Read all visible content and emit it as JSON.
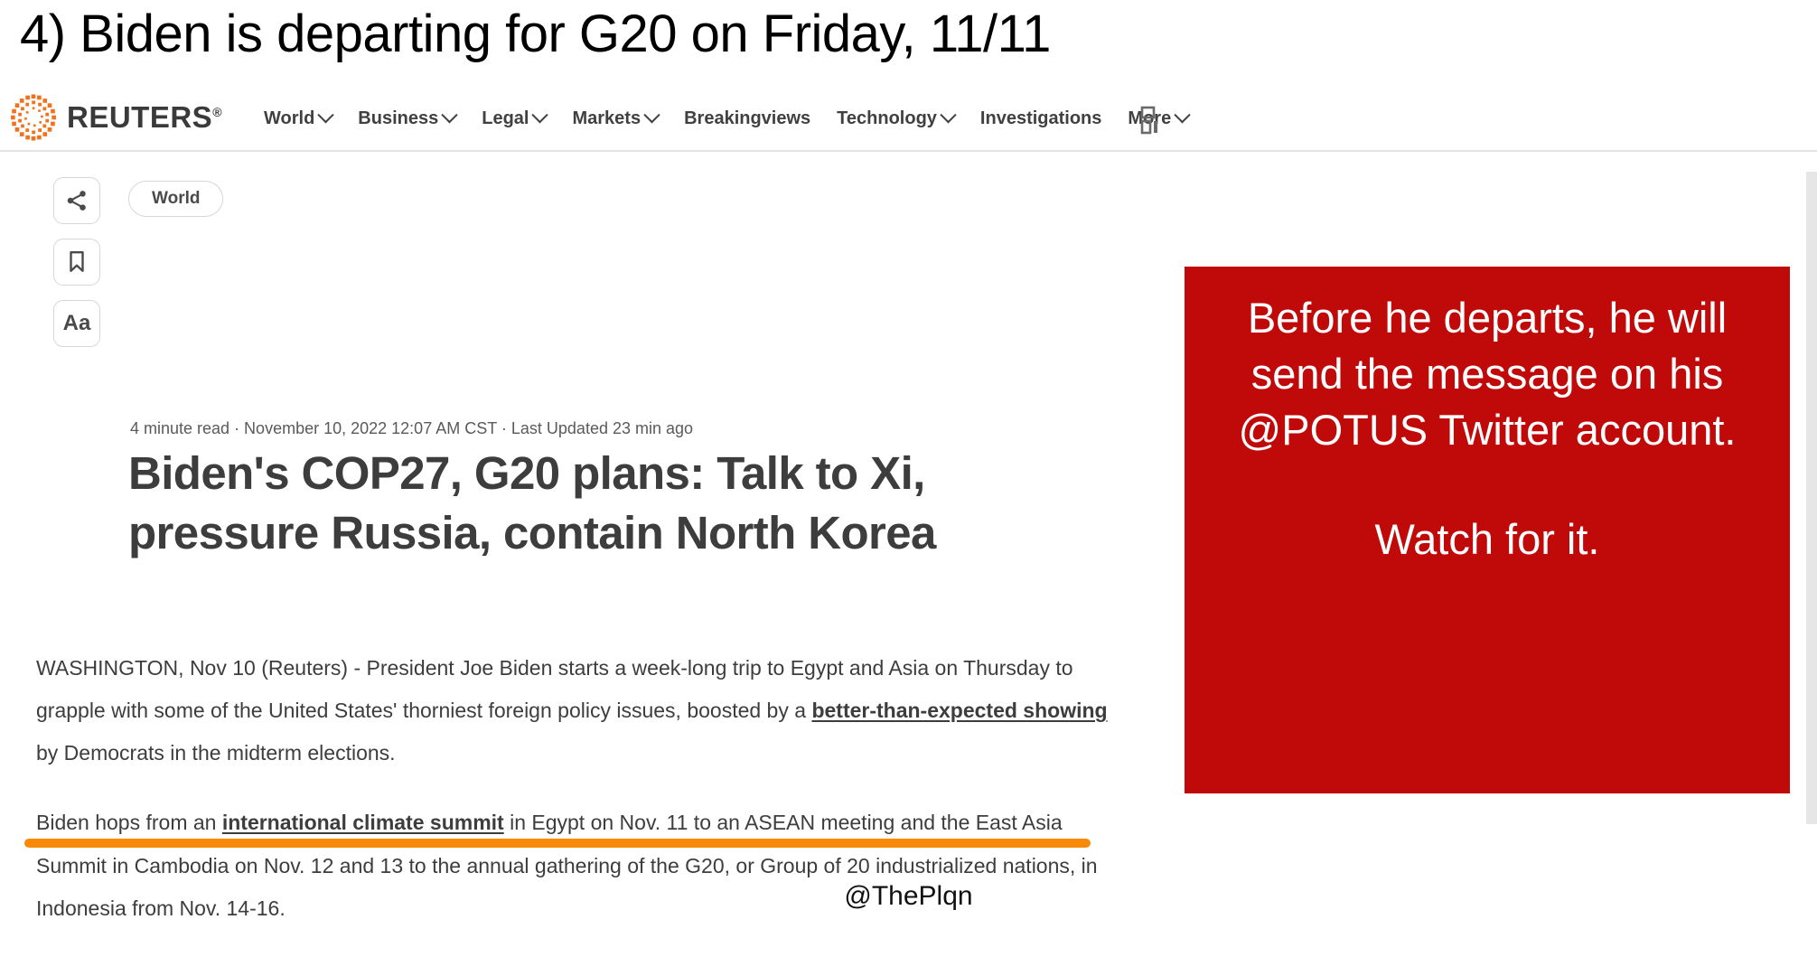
{
  "slide": {
    "title": "4) Biden is departing for G20 on Friday, 11/11",
    "watermark": "@ThePlqn"
  },
  "site": {
    "brand": "REUTERS",
    "brand_registered": "®",
    "logo_icon": "reuters-dot-spiral-logo",
    "brand_color": "#f97316",
    "nav": [
      {
        "label": "World",
        "has_dropdown": true
      },
      {
        "label": "Business",
        "has_dropdown": true
      },
      {
        "label": "Legal",
        "has_dropdown": true
      },
      {
        "label": "Markets",
        "has_dropdown": true
      },
      {
        "label": "Breakingviews",
        "has_dropdown": false
      },
      {
        "label": "Technology",
        "has_dropdown": true
      },
      {
        "label": "Investigations",
        "has_dropdown": false
      },
      {
        "label": "More",
        "has_dropdown": true
      }
    ],
    "nav_end_icon": "menu-grid-icon"
  },
  "article": {
    "rail_buttons": [
      {
        "icon": "share-icon",
        "label": ""
      },
      {
        "icon": "bookmark-icon",
        "label": ""
      },
      {
        "icon": "text-size-icon",
        "label": "Aa"
      }
    ],
    "section_badge": "World",
    "meta": "4 minute read · November 10, 2022 12:07 AM CST · Last Updated 23 min ago",
    "headline": "Biden's COP27, G20 plans: Talk to Xi, pressure Russia, contain North Korea",
    "paragraphs": [
      {
        "parts": [
          {
            "text": "WASHINGTON, Nov 10 (Reuters) - President Joe Biden starts a week-long trip to Egypt and Asia on Thursday to grapple with some of the United States' thorniest foreign policy issues, boosted by a ",
            "link": false
          },
          {
            "text": "better-than-expected showing",
            "link": true
          },
          {
            "text": " by Democrats in the midterm elections.",
            "link": false
          }
        ]
      },
      {
        "parts": [
          {
            "text": "Biden hops from an ",
            "link": false
          },
          {
            "text": "international climate summit",
            "link": true
          },
          {
            "text": " in Egypt on Nov. 11 to an ASEAN meeting and the East Asia Summit in Cambodia on Nov. 12 and 13 to the annual gathering of the G20, or Group of 20 industrialized nations, in Indonesia from Nov. 14-16.",
            "link": false
          }
        ]
      }
    ],
    "highlight_color": "#f98a07"
  },
  "callout": {
    "background_color": "#c00a0a",
    "text_color": "#ffffff",
    "main_text": "Before he departs, he will send the message on his @POTUS Twitter account.",
    "tail_text": "Watch for it."
  }
}
